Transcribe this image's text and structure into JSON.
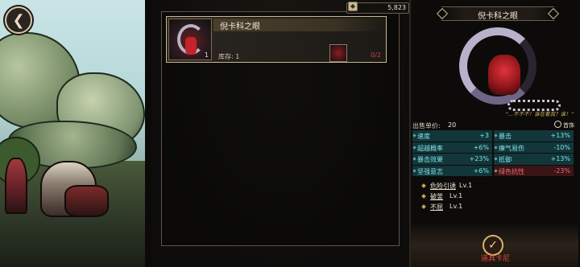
{
  "header": {
    "back_icon": "back-arrow-icon",
    "currency_icon": "coin-icon",
    "currency": "5,823"
  },
  "inventory": {
    "items": [
      {
        "name": "倪卡科之眼",
        "level": "1",
        "stock_label": "库存:",
        "stock": "1",
        "count": "0/2"
      }
    ]
  },
  "detail": {
    "title": "倪卡科之眼",
    "quote": "“…不不不！谁在看我？谁！”",
    "price_label": "出售单价:",
    "price": "20",
    "slot_label": "首饰",
    "stats": [
      {
        "name": "速度",
        "value": "+3",
        "negative": false
      },
      {
        "name": "暴击",
        "value": "+13%",
        "negative": false
      },
      {
        "name": "超越概率",
        "value": "+6%",
        "negative": false
      },
      {
        "name": "瘴气易伤",
        "value": "-10%",
        "negative": false
      },
      {
        "name": "暴击效果",
        "value": "+23%",
        "negative": false
      },
      {
        "name": "抵御",
        "value": "+13%",
        "negative": false
      },
      {
        "name": "坚强意志",
        "value": "+6%",
        "negative": false
      },
      {
        "name": "绿色抗性",
        "value": "-23%",
        "negative": true
      }
    ],
    "skills": [
      {
        "name": "危险引诱",
        "level": "Lv.1"
      },
      {
        "name": "破釜",
        "level": "Lv.1"
      },
      {
        "name": "不屈",
        "level": "Lv.1"
      }
    ],
    "confirm_label": "道具卡尼",
    "colors": {
      "positive": "#7fe3e8",
      "negative": "#f06c6c",
      "gold": "#d8b46a"
    }
  }
}
